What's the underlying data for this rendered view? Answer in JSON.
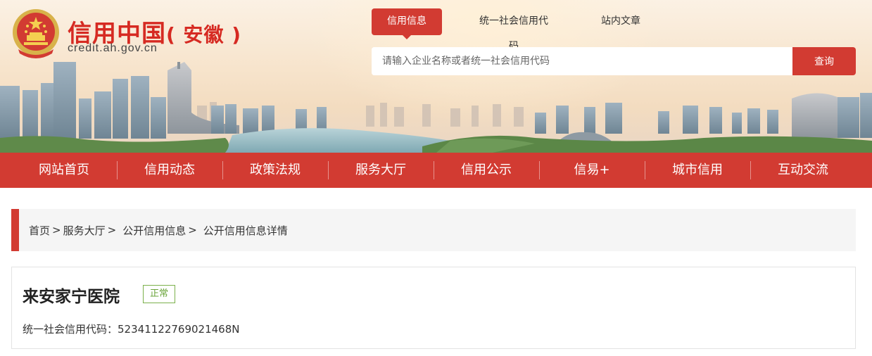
{
  "header": {
    "site_name": "信用中国",
    "region": "( 安徽 )",
    "domain": "credit.ah.gov.cn",
    "emblem_icon": "national-emblem-icon"
  },
  "search": {
    "tabs": [
      {
        "label": "信用信息",
        "active": true
      },
      {
        "label": "统一社会信用代码",
        "active": false
      },
      {
        "label": "站内文章",
        "active": false
      }
    ],
    "placeholder": "请输入企业名称或者统一社会信用代码",
    "button_label": "查询"
  },
  "nav": {
    "items": [
      "网站首页",
      "信用动态",
      "政策法规",
      "服务大厅",
      "信用公示",
      "信易+",
      "城市信用",
      "互动交流"
    ]
  },
  "breadcrumb": {
    "items": [
      "首页",
      "服务大厅",
      "公开信用信息"
    ],
    "current": "公开信用信息详情",
    "separator": ">"
  },
  "entity": {
    "name": "来安家宁医院",
    "status": "正常",
    "credit_code_label": "统一社会信用代码：",
    "credit_code": "52341122769021468N"
  },
  "colors": {
    "brand_red": "#d23b32",
    "status_green": "#6aa43a"
  }
}
